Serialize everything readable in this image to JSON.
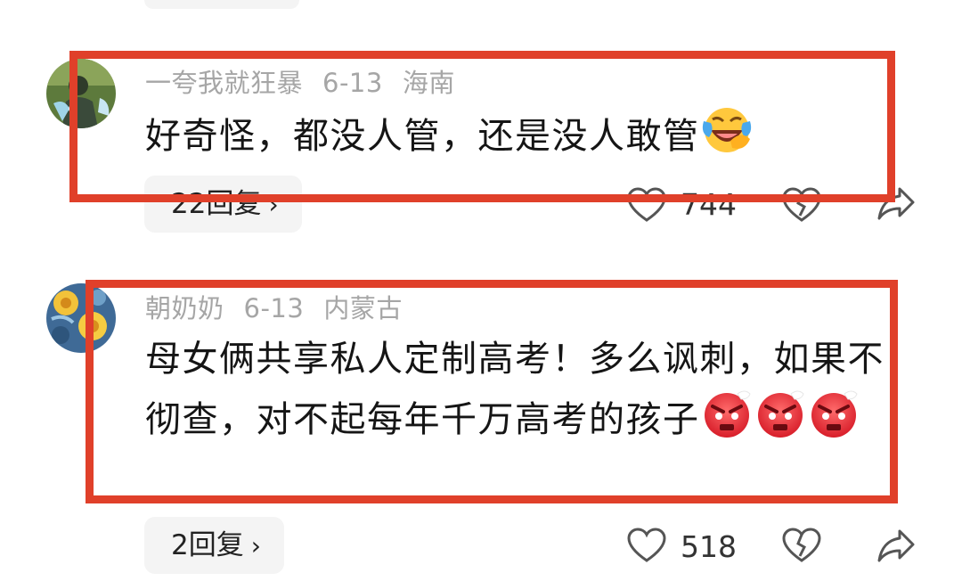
{
  "comments": [
    {
      "username": "一夸我就狂暴",
      "date": "6-13",
      "location": "海南",
      "text": "好奇怪，都没人管，还是没人敢管",
      "emoji": "laughing-crying-emoji",
      "replies_label": "22回复",
      "likes": "744"
    },
    {
      "username": "朝奶奶",
      "date": "6-13",
      "location": "内蒙古",
      "text": "母女俩共享私人定制高考！多么讽刺，如果不彻查，对不起每年千万高考的孩子",
      "emoji": "angry-face-emoji",
      "replies_label": "2回复",
      "likes": "518"
    }
  ],
  "icons": {
    "reply_chevron": "chevron-right-icon",
    "like": "heart-outline-icon",
    "dislike": "broken-heart-icon",
    "share": "share-arrow-icon"
  },
  "colors": {
    "highlight": "#e0402a",
    "meta": "#a6a6a6",
    "pill_bg": "#f4f4f4"
  }
}
